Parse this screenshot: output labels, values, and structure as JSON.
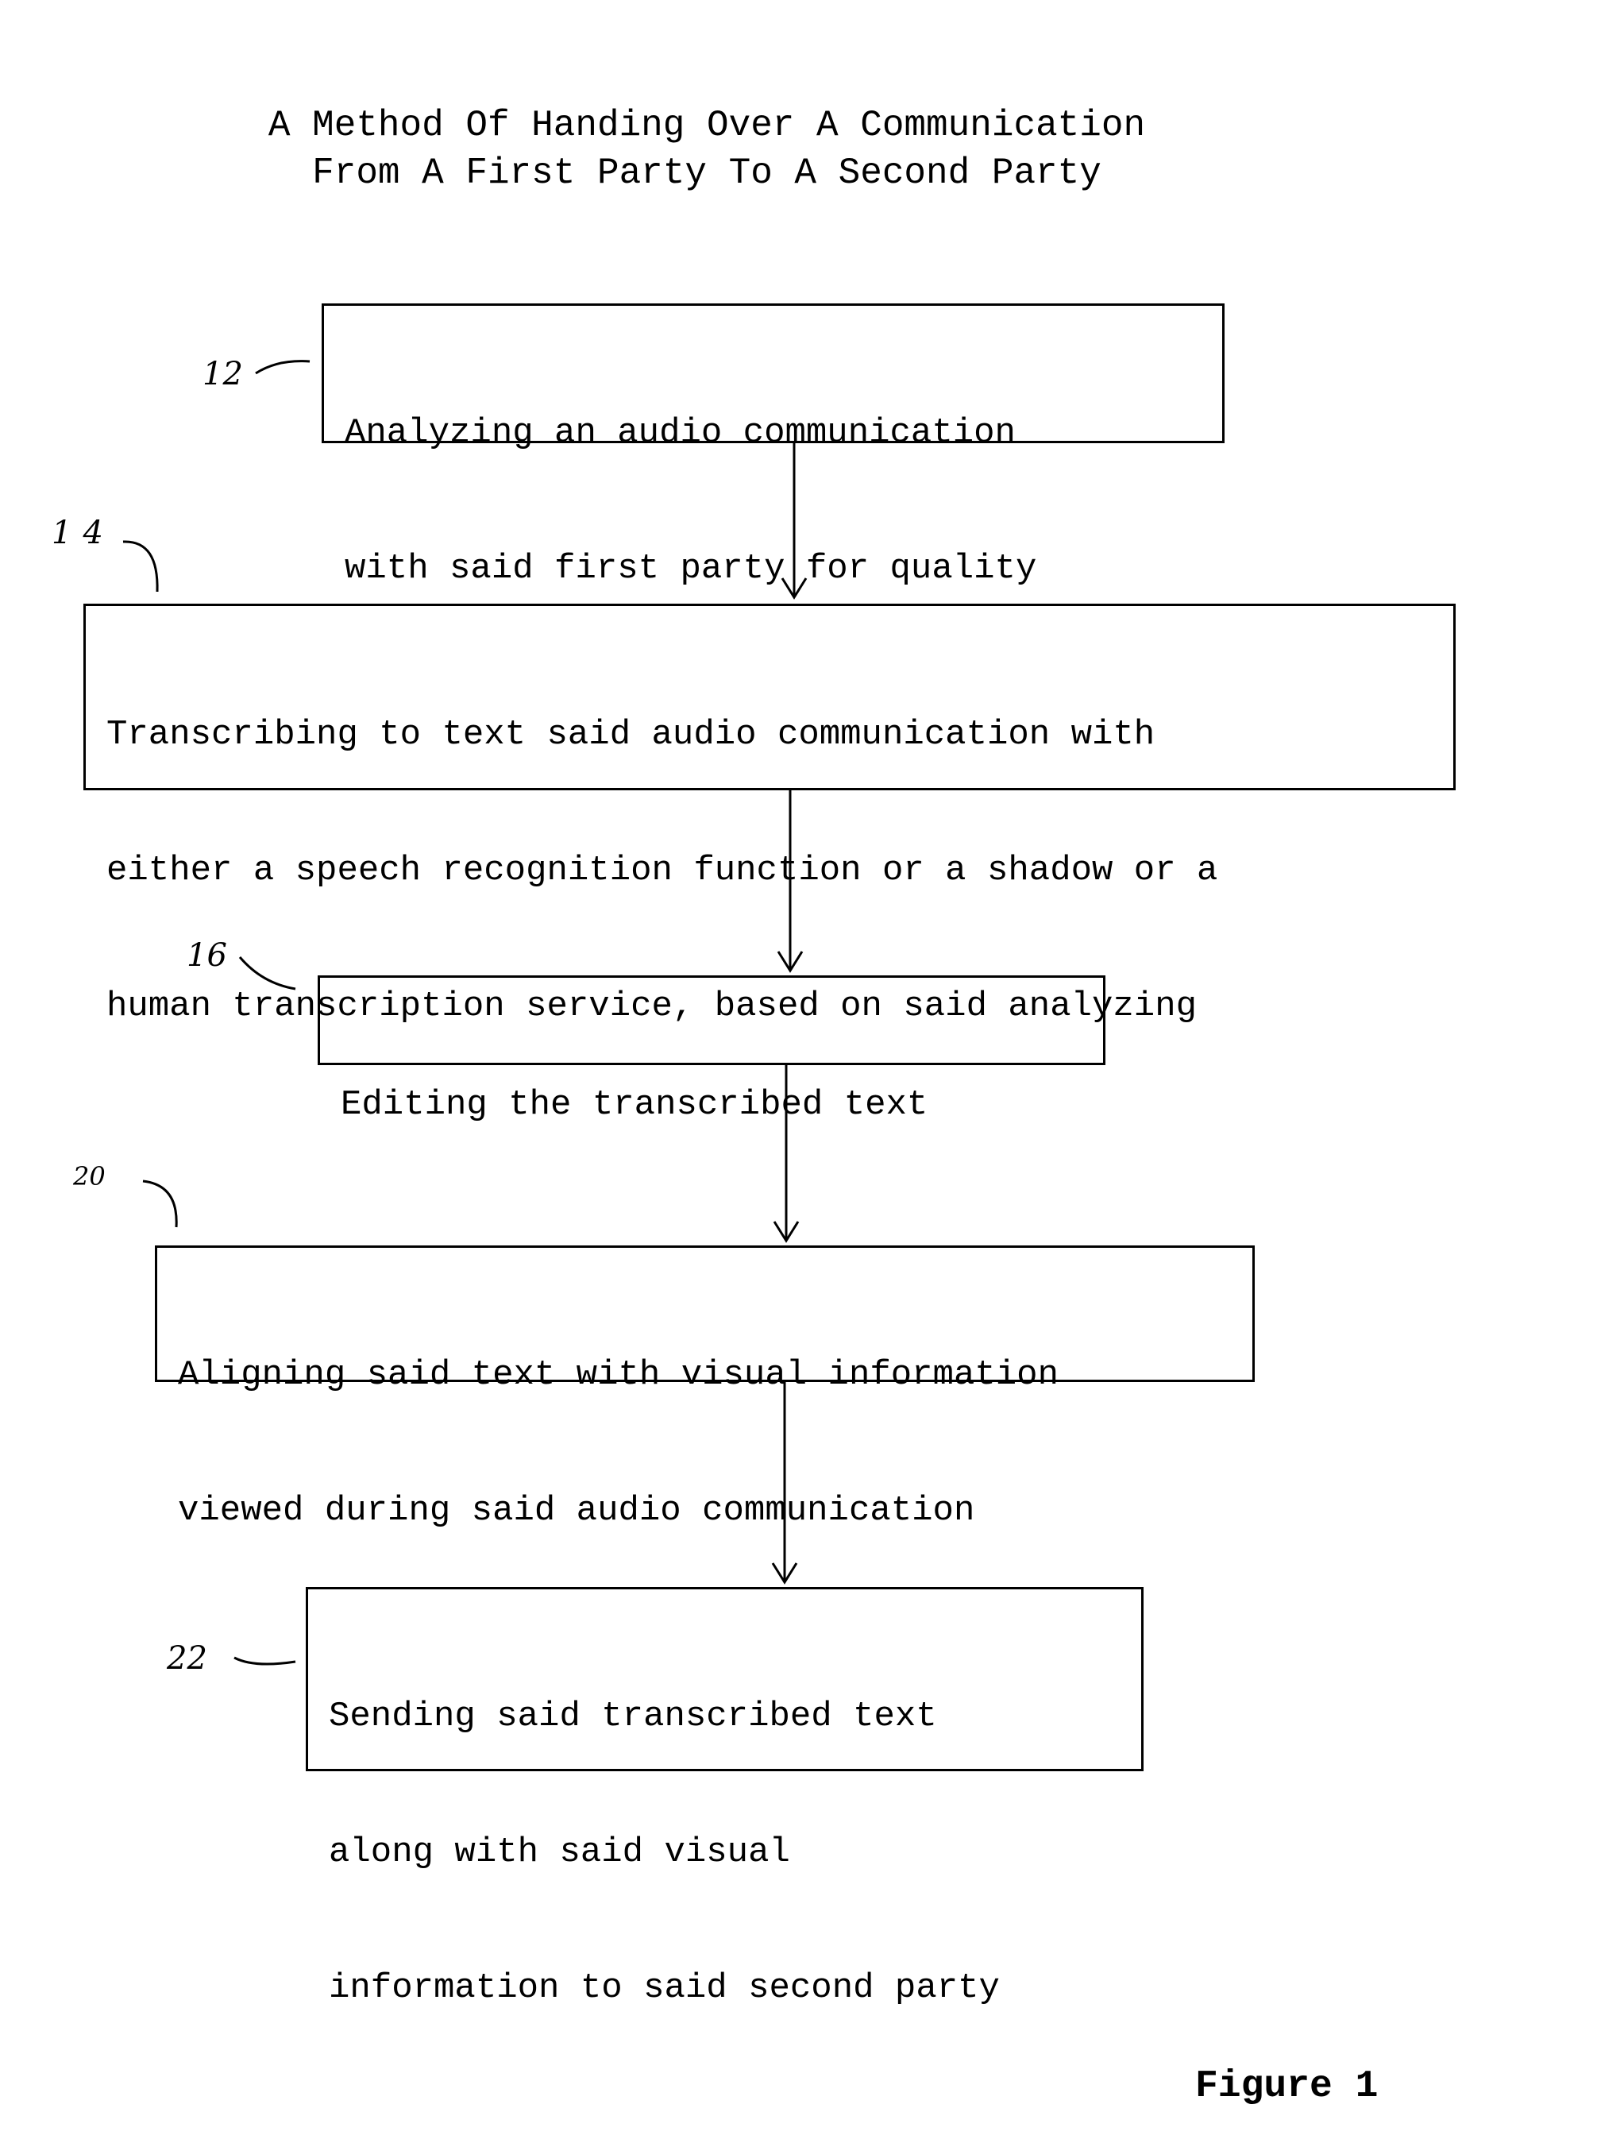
{
  "title": {
    "line1": "A Method Of Handing Over A Communication",
    "line2": "From A First Party To A Second Party"
  },
  "steps": [
    {
      "ref": "12",
      "lines": [
        "Analyzing an audio communication",
        "with said first party for quality"
      ]
    },
    {
      "ref": "14",
      "lines": [
        "Transcribing to text said audio communication with",
        "either a speech recognition function or a shadow or a",
        "human transcription service, based on said analyzing"
      ]
    },
    {
      "ref": "16",
      "lines": [
        "Editing the transcribed text"
      ]
    },
    {
      "ref": "20",
      "lines": [
        "Aligning said text with visual information",
        "viewed during said audio communication"
      ]
    },
    {
      "ref": "22",
      "lines": [
        "Sending said transcribed text",
        "along with said visual",
        "information to said second party"
      ]
    }
  ],
  "figure_label": "Figure 1"
}
